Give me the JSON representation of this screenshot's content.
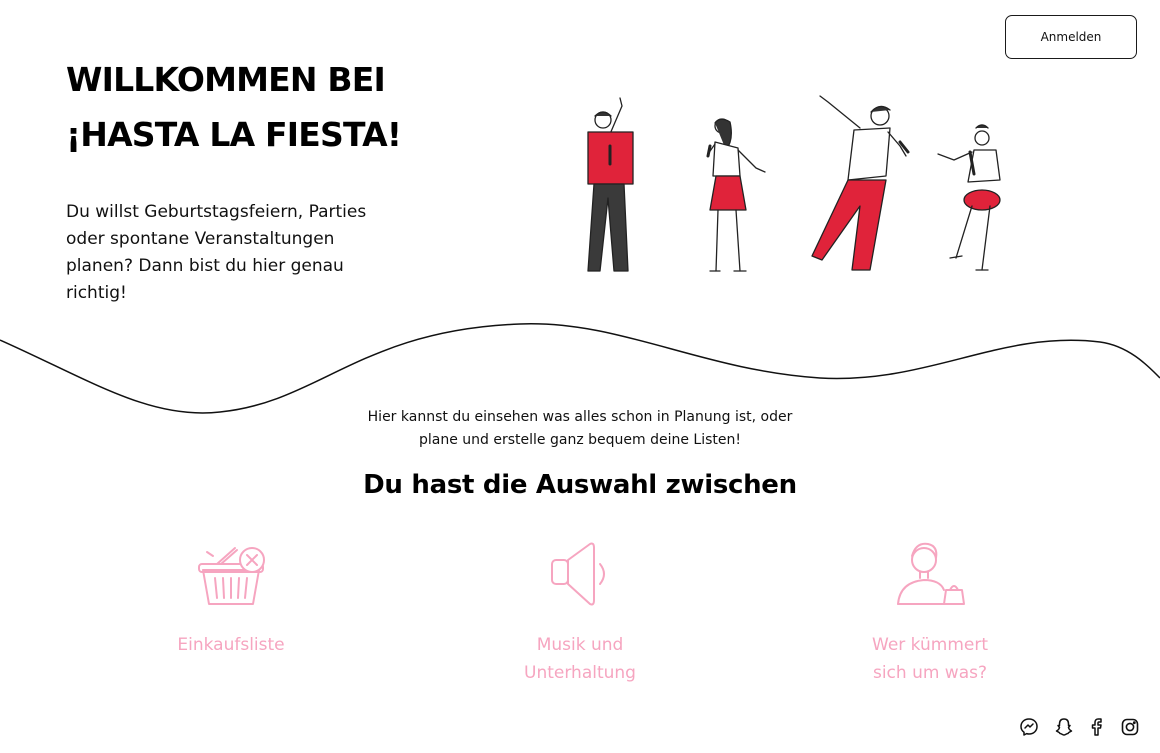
{
  "header": {
    "login_label": "Anmelden"
  },
  "hero": {
    "title_line1": "WILLKOMMEN BEI",
    "title_line2": "¡HASTA LA FIESTA!",
    "text": "Du willst Geburtstagsfeiern, Parties oder spontane Veranstaltungen planen? Dann bist du hier genau richtig!"
  },
  "intro": {
    "line1": "Hier kannst du einsehen was alles schon in Planung ist, oder",
    "line2": "plane und erstelle ganz bequem deine Listen!"
  },
  "choices": {
    "title": "Du hast die Auswahl zwischen",
    "items": [
      {
        "label_line1": "Einkaufsliste",
        "label_line2": "",
        "icon": "shopping-basket-icon"
      },
      {
        "label_line1": "Musik und",
        "label_line2": "Unterhaltung",
        "icon": "speaker-icon"
      },
      {
        "label_line1": "Wer kümmert",
        "label_line2": "sich um was?",
        "icon": "person-task-icon"
      }
    ]
  },
  "social": [
    "messenger-icon",
    "snapchat-icon",
    "facebook-icon",
    "instagram-icon"
  ],
  "colors": {
    "accent_pink": "#f6a5c0",
    "accent_red": "#e0233a"
  }
}
